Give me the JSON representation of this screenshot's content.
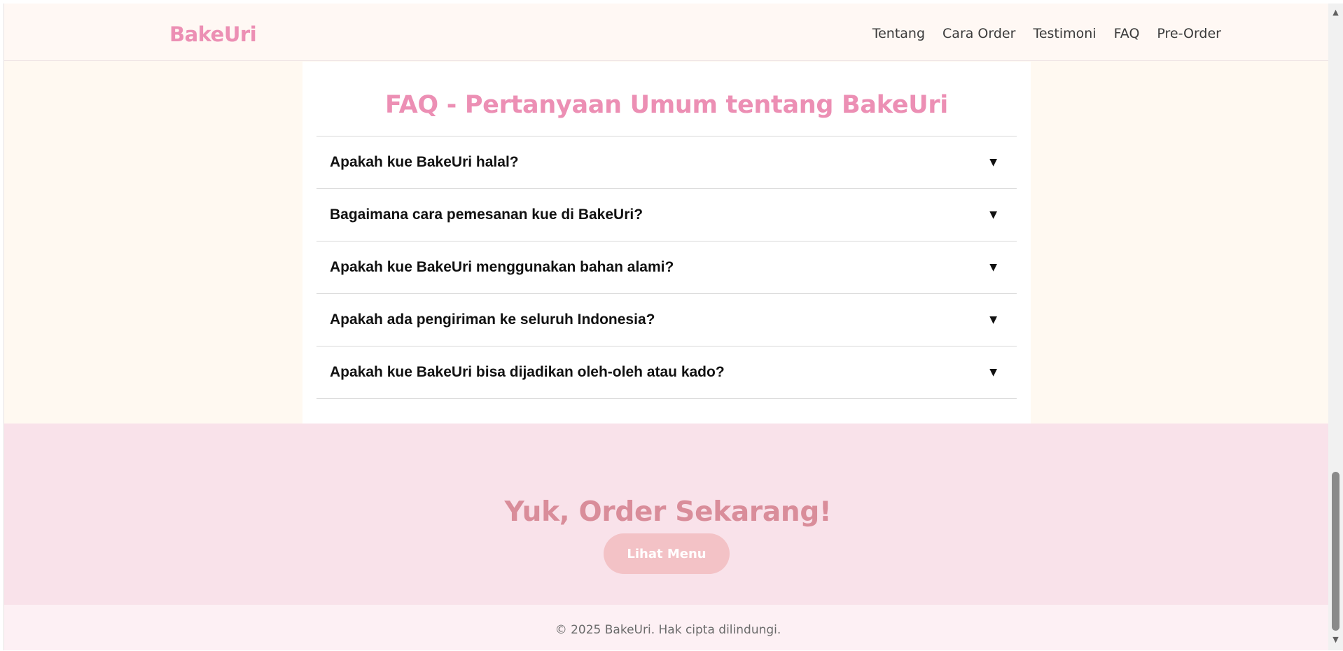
{
  "header": {
    "logo": "BakeUri",
    "nav": [
      {
        "label": "Tentang"
      },
      {
        "label": "Cara Order"
      },
      {
        "label": "Testimoni"
      },
      {
        "label": "FAQ"
      },
      {
        "label": "Pre-Order"
      }
    ]
  },
  "faq": {
    "title": "FAQ - Pertanyaan Umum tentang BakeUri",
    "arrow": "▼",
    "items": [
      {
        "question": "Apakah kue BakeUri halal?"
      },
      {
        "question": "Bagaimana cara pemesanan kue di BakeUri?"
      },
      {
        "question": "Apakah kue BakeUri menggunakan bahan alami?"
      },
      {
        "question": "Apakah ada pengiriman ke seluruh Indonesia?"
      },
      {
        "question": "Apakah kue BakeUri bisa dijadikan oleh-oleh atau kado?"
      }
    ]
  },
  "cta": {
    "title": "Yuk, Order Sekarang!",
    "button_label": "Lihat Menu"
  },
  "footer": {
    "text": "© 2025 BakeUri. Hak cipta dilindungi."
  },
  "scrollbar": {
    "up_icon": "▲",
    "down_icon": "▼"
  },
  "colors": {
    "brand_pink": "#ec8fb4",
    "cta_text": "#d98d9a",
    "cta_button": "#f3c2c6",
    "cta_bg": "#f9e2ea",
    "page_bg": "#fff9f1"
  }
}
